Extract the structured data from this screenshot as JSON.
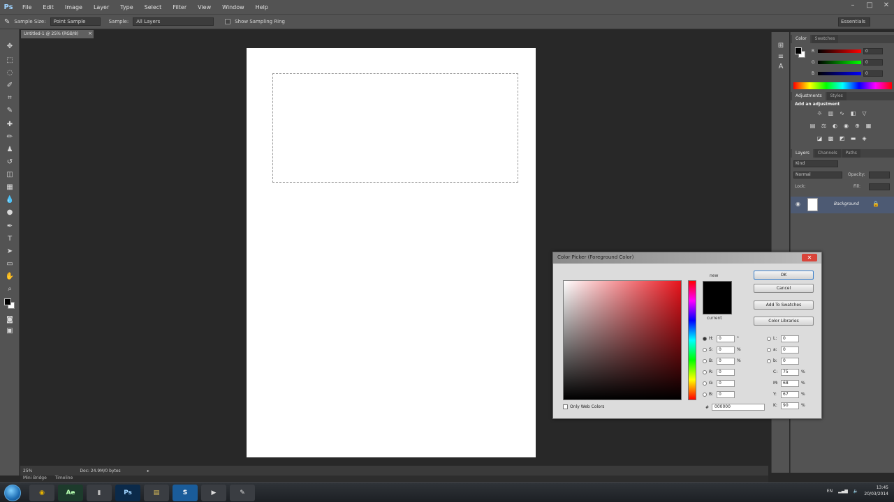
{
  "app": {
    "logo": "Ps"
  },
  "menubar": {
    "items": [
      "File",
      "Edit",
      "Image",
      "Layer",
      "Type",
      "Select",
      "Filter",
      "View",
      "Window",
      "Help"
    ]
  },
  "window_controls": {
    "minimize": "–",
    "maximize": "□",
    "close": "✕"
  },
  "optionsbar": {
    "sample_size_label": "Sample Size:",
    "sample_size_value": "Point Sample",
    "sample_label": "Sample:",
    "sample_value": "All Layers",
    "show_ring_label": "Show Sampling Ring",
    "workspace": "Essentials"
  },
  "document": {
    "tab_title": "Untitled-1 @ 25% (RGB/8)",
    "tab_close": "×"
  },
  "statusbar": {
    "zoom": "25%",
    "info": "Doc: 24.9M/0 bytes"
  },
  "mini_bridge": {
    "tabs": [
      "Mini Bridge",
      "Timeline"
    ]
  },
  "panels": {
    "color_tabs": [
      "Color",
      "Swatches"
    ],
    "color_sliders": [
      {
        "label": "R",
        "value": "0",
        "track": "linear-gradient(to right,#000,#f00)"
      },
      {
        "label": "G",
        "value": "0",
        "track": "linear-gradient(to right,#000,#0f0)"
      },
      {
        "label": "B",
        "value": "0",
        "track": "linear-gradient(to right,#000,#00f)"
      }
    ],
    "adjust_tabs": [
      "Adjustments",
      "Styles"
    ],
    "adjust_title": "Add an adjustment",
    "layers_tabs": [
      "Layers",
      "Channels",
      "Paths"
    ],
    "layers_kind": "Kind",
    "layers_blend": "Normal",
    "layers_opacity": "Opacity:",
    "layers_fill": "Fill:",
    "layers_lock": "Lock:",
    "layer_name": "Background"
  },
  "color_picker": {
    "title": "Color Picker (Foreground Color)",
    "close": "✕",
    "new_label": "new",
    "current_label": "current",
    "preview_color": "#000000",
    "buttons": {
      "ok": "OK",
      "cancel": "Cancel",
      "add_swatches": "Add To Swatches",
      "libraries": "Color Libraries"
    },
    "fields_left": [
      {
        "label": "H:",
        "value": "0",
        "unit": "°",
        "selected": true
      },
      {
        "label": "S:",
        "value": "0",
        "unit": "%",
        "selected": false
      },
      {
        "label": "B:",
        "value": "0",
        "unit": "%",
        "selected": false
      },
      {
        "label": "R:",
        "value": "0",
        "unit": "",
        "selected": false
      },
      {
        "label": "G:",
        "value": "0",
        "unit": "",
        "selected": false
      },
      {
        "label": "B:",
        "value": "0",
        "unit": "",
        "selected": false
      }
    ],
    "fields_right": [
      {
        "label": "L:",
        "value": "0",
        "unit": ""
      },
      {
        "label": "a:",
        "value": "0",
        "unit": ""
      },
      {
        "label": "b:",
        "value": "0",
        "unit": ""
      },
      {
        "label": "C:",
        "value": "75",
        "unit": "%"
      },
      {
        "label": "M:",
        "value": "68",
        "unit": "%"
      },
      {
        "label": "Y:",
        "value": "67",
        "unit": "%"
      },
      {
        "label": "K:",
        "value": "90",
        "unit": "%"
      }
    ],
    "web_colors_label": "Only Web Colors",
    "hex_prefix": "#",
    "hex_value": "000000"
  },
  "taskbar": {
    "apps": [
      {
        "name": "chrome",
        "label": "◉",
        "bg": "#3a3d42",
        "fg": "#e8b400"
      },
      {
        "name": "after-effects",
        "label": "Ae",
        "bg": "#1d3b2c",
        "fg": "#b6ffb0"
      },
      {
        "name": "file",
        "label": "▮",
        "bg": "#3a3d42",
        "fg": "#bbbbbb"
      },
      {
        "name": "photoshop",
        "label": "Ps",
        "bg": "#0b2a4a",
        "fg": "#9fd3ff"
      },
      {
        "name": "explorer",
        "label": "▤",
        "bg": "#3a3d42",
        "fg": "#e3c45a"
      },
      {
        "name": "skype",
        "label": "S",
        "bg": "#1a5c9a",
        "fg": "#ffffff"
      },
      {
        "name": "media",
        "label": "▶",
        "bg": "#3a3d42",
        "fg": "#dddddd"
      },
      {
        "name": "other",
        "label": "✎",
        "bg": "#3a3d42",
        "fg": "#dddddd"
      }
    ],
    "tray": "EN",
    "time": "13:45",
    "date": "20/03/2014"
  }
}
